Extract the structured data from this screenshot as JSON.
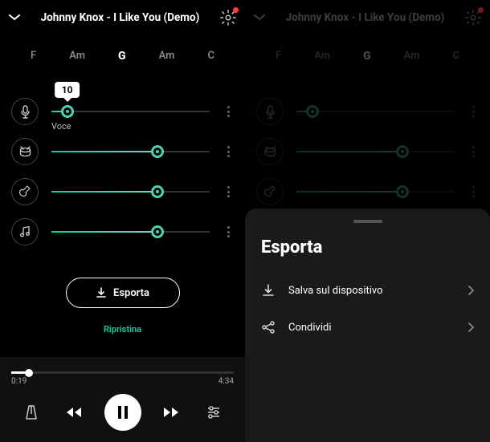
{
  "left": {
    "title": "Johnny Knox - I Like You (Demo)",
    "chords": [
      "F",
      "Am",
      "G",
      "Am",
      "C"
    ],
    "activeChordIndex": 2,
    "tracks": [
      {
        "icon": "mic",
        "value": 10,
        "label": "Voce",
        "tooltip": "10"
      },
      {
        "icon": "drums",
        "value": 67
      },
      {
        "icon": "guitar",
        "value": 67
      },
      {
        "icon": "music",
        "value": 67
      }
    ],
    "exportLabel": "Esporta",
    "restoreLabel": "Ripristina",
    "player": {
      "current": "0:19",
      "total": "4:34",
      "progressPct": 8
    }
  },
  "right": {
    "title": "Johnny Knox - I Like You (Demo)",
    "chords": [
      "F",
      "Am",
      "G",
      "Am",
      "C"
    ],
    "activeChordIndex": 2,
    "tracks": [
      {
        "icon": "mic",
        "value": 10
      },
      {
        "icon": "drums",
        "value": 67
      },
      {
        "icon": "guitar",
        "value": 67
      }
    ],
    "sheet": {
      "title": "Esporta",
      "items": [
        {
          "icon": "download",
          "label": "Salva sul dispositivo"
        },
        {
          "icon": "share",
          "label": "Condividi"
        }
      ]
    }
  },
  "colors": {
    "accent": "#00d4a4"
  }
}
